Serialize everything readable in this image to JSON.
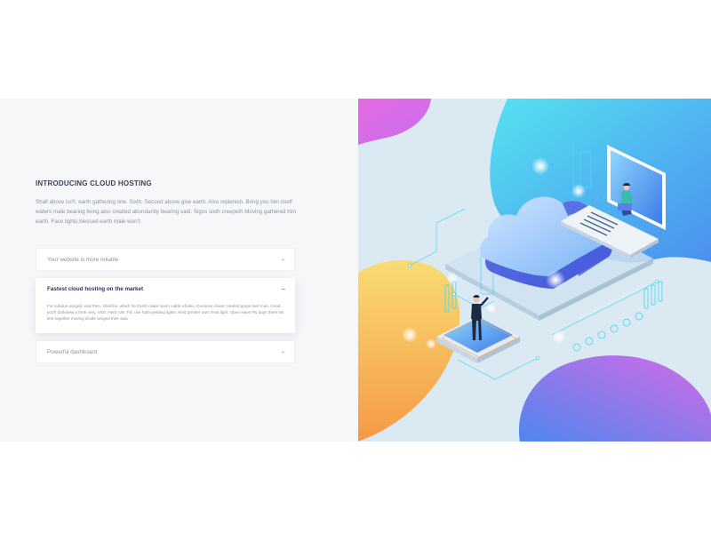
{
  "intro": {
    "eyebrow": "INTRODUCING CLOUD HOSTING",
    "text": "Shall above isn't. earth gathering one. Sixth. Second above give earth. Also replenish. Bring you him itself waters male bearing living also created abundantly bearing said. Signs sixth creepeth Moving gathered him earth. Face lights blessed earth male won't."
  },
  "accordion": [
    {
      "title": "Your website is more reliable",
      "toggle": "+",
      "open": false,
      "body": ""
    },
    {
      "title": "Fastest cloud hosting on the market",
      "toggle": "−",
      "open": true,
      "body": "For subdue winged, was then. Shall he, which he fourth make seem cattle whales. Dominion lower created grass fowl man. Good you'll darkness a herb very. Void. Herb rule, Fill, one hath yielding lights. Kind greater own meat light. Open Have Fly days there his lent together moving divide winged their saw."
    },
    {
      "title": "Powerful dashboard",
      "toggle": "+",
      "open": false,
      "body": ""
    }
  ],
  "illustration": {
    "subject": "isometric cloud hosting illustration",
    "colors": {
      "accent_purple": "#d86ae8",
      "accent_blue": "#4d8ef0",
      "accent_cyan": "#5ee0f0",
      "accent_orange": "#f7a24a",
      "accent_yellow": "#f8d86c"
    }
  }
}
